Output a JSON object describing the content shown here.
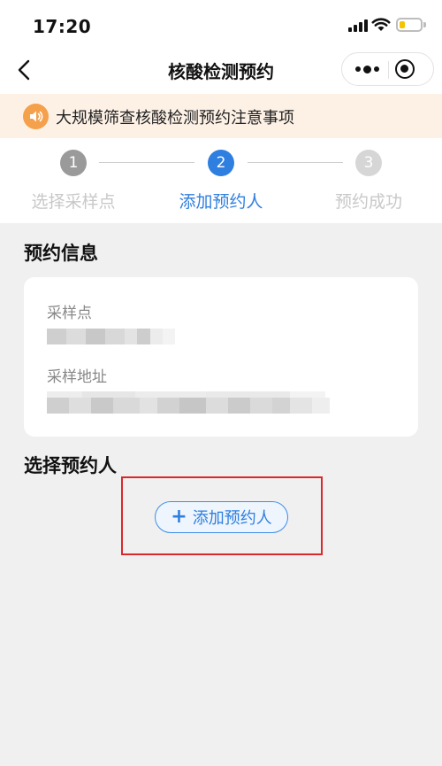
{
  "status_bar": {
    "time": "17:20"
  },
  "nav": {
    "title": "核酸检测预约"
  },
  "notice": {
    "text": "大规模筛查核酸检测预约注意事项"
  },
  "steps": [
    {
      "number": "1",
      "label": "选择采样点",
      "state": "done"
    },
    {
      "number": "2",
      "label": "添加预约人",
      "state": "active"
    },
    {
      "number": "3",
      "label": "预约成功",
      "state": "pending"
    }
  ],
  "booking_info": {
    "title": "预约信息",
    "site_label": "采样点",
    "address_label": "采样地址"
  },
  "select_person": {
    "title": "选择预约人",
    "add_button": "添加预约人"
  },
  "colors": {
    "accent": "#2e7fdf",
    "step_done": "#9a9a9a",
    "step_pending": "#d6d6d6",
    "notice_bg": "#fdf1e6",
    "highlight": "#d9292c"
  }
}
